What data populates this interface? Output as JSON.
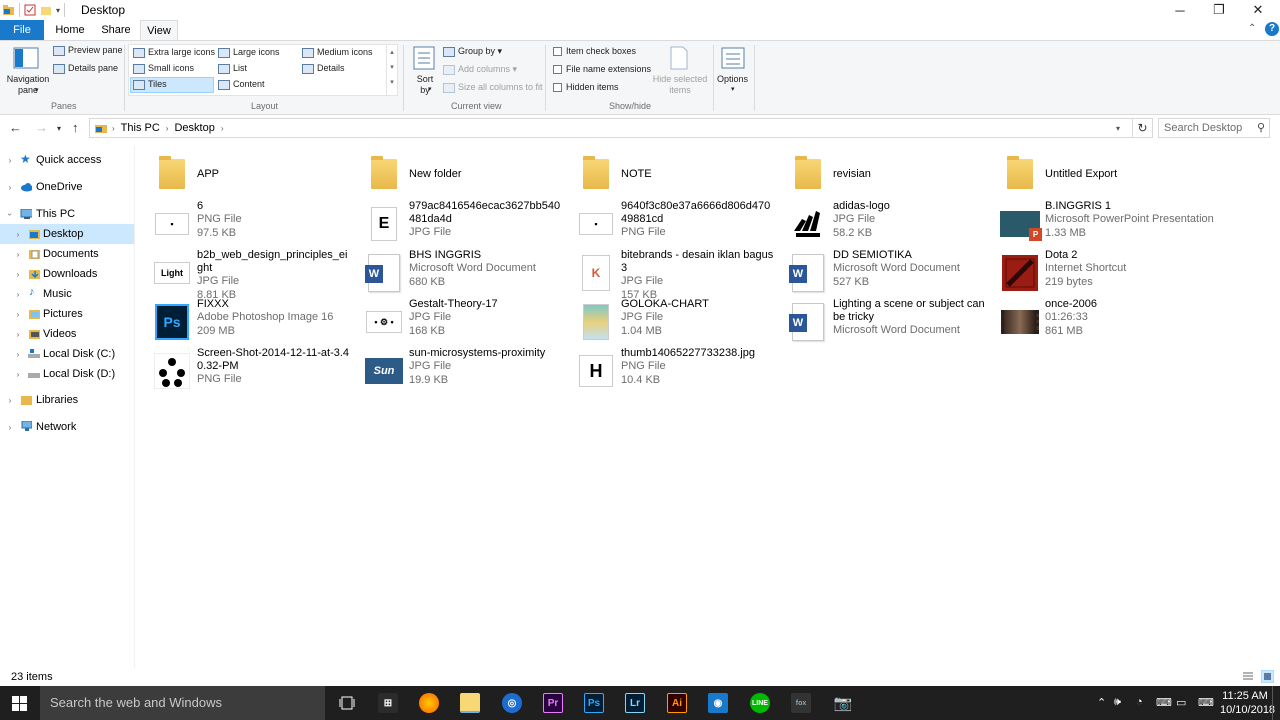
{
  "window": {
    "title": "Desktop",
    "minimize": "─",
    "maximize": "❐",
    "close": "✕"
  },
  "tabs": {
    "file": "File",
    "home": "Home",
    "share": "Share",
    "view": "View"
  },
  "ribbon": {
    "panes": {
      "navigation_pane": "Navigation pane",
      "preview_pane": "Preview pane",
      "details_pane": "Details pane",
      "group": "Panes"
    },
    "layout": {
      "extra_large_icons": "Extra large icons",
      "large_icons": "Large icons",
      "medium_icons": "Medium icons",
      "small_icons": "Small icons",
      "list": "List",
      "details": "Details",
      "tiles": "Tiles",
      "content": "Content",
      "group": "Layout"
    },
    "current_view": {
      "sort_by": "Sort by",
      "group_by": "Group by",
      "add_columns": "Add columns",
      "size_all_columns": "Size all columns to fit",
      "group": "Current view"
    },
    "show_hide": {
      "item_check_boxes": "Item check boxes",
      "file_name_extensions": "File name extensions",
      "hidden_items": "Hidden items",
      "hide_selected_items": "Hide selected items",
      "group": "Show/hide"
    },
    "options": "Options"
  },
  "address": {
    "crumbs": [
      "This PC",
      "Desktop"
    ],
    "search_placeholder": "Search Desktop"
  },
  "nav": {
    "items": [
      {
        "label": "Quick access"
      },
      {
        "label": "OneDrive"
      },
      {
        "label": "This PC"
      },
      {
        "label": "Desktop"
      },
      {
        "label": "Documents"
      },
      {
        "label": "Downloads"
      },
      {
        "label": "Music"
      },
      {
        "label": "Pictures"
      },
      {
        "label": "Videos"
      },
      {
        "label": "Local Disk (C:)"
      },
      {
        "label": "Local Disk (D:)"
      },
      {
        "label": "Libraries"
      },
      {
        "label": "Network"
      }
    ]
  },
  "files": [
    {
      "name": "APP",
      "type": "",
      "size": "",
      "icon": "folder"
    },
    {
      "name": "New folder",
      "type": "",
      "size": "",
      "icon": "folder"
    },
    {
      "name": "NOTE",
      "type": "",
      "size": "",
      "icon": "folder"
    },
    {
      "name": "revisian",
      "type": "",
      "size": "",
      "icon": "folder"
    },
    {
      "name": "Untitled Export",
      "type": "",
      "size": "",
      "icon": "folder"
    },
    {
      "name": "6",
      "type": "PNG File",
      "size": "97.5 KB",
      "icon": "image"
    },
    {
      "name": "979ac8416546ecac3627bb540481da4d",
      "type": "JPG File",
      "size": "",
      "icon": "image-e"
    },
    {
      "name": "9640f3c80e37a6666d806d47049881cd",
      "type": "PNG File",
      "size": "",
      "icon": "image"
    },
    {
      "name": "adidas-logo",
      "type": "JPG File",
      "size": "58.2 KB",
      "icon": "adidas"
    },
    {
      "name": "B.INGGRIS 1",
      "type": "Microsoft PowerPoint Presentation",
      "size": "1.33 MB",
      "icon": "pptx"
    },
    {
      "name": "b2b_web_design_principles_eight",
      "type": "JPG File",
      "size": "8.81 KB",
      "icon": "image-light"
    },
    {
      "name": "BHS INGGRIS",
      "type": "Microsoft Word Document",
      "size": "680 KB",
      "icon": "word"
    },
    {
      "name": "bitebrands - desain iklan bagus 3",
      "type": "JPG File",
      "size": "157 KB",
      "icon": "image-k"
    },
    {
      "name": "DD SEMIOTIKA",
      "type": "Microsoft Word Document",
      "size": "527 KB",
      "icon": "word"
    },
    {
      "name": "Dota 2",
      "type": "Internet Shortcut",
      "size": "219 bytes",
      "icon": "dota"
    },
    {
      "name": "FIXXX",
      "type": "Adobe Photoshop Image 16",
      "size": "209 MB",
      "icon": "psd"
    },
    {
      "name": "Gestalt-Theory-17",
      "type": "JPG File",
      "size": "168 KB",
      "icon": "image-gestalt"
    },
    {
      "name": "GOLOKA-CHART",
      "type": "JPG File",
      "size": "1.04 MB",
      "icon": "image-chart"
    },
    {
      "name": "Lighting a scene or subject can be tricky",
      "type": "Microsoft Word Document",
      "size": "",
      "icon": "word"
    },
    {
      "name": "once-2006",
      "type": "01:26:33",
      "size": "861 MB",
      "icon": "video"
    },
    {
      "name": "Screen-Shot-2014-12-11-at-3.40.32-PM",
      "type": "PNG File",
      "size": "",
      "icon": "image-screen"
    },
    {
      "name": "sun-microsystems-proximity",
      "type": "JPG File",
      "size": "19.9 KB",
      "icon": "sun"
    },
    {
      "name": "thumb14065227733238.jpg",
      "type": "PNG File",
      "size": "10.4 KB",
      "icon": "image-h"
    }
  ],
  "status": {
    "count": "23 items"
  },
  "taskbar": {
    "search": "Search the web and Windows",
    "time": "11:25 AM",
    "date": "10/10/2018"
  }
}
